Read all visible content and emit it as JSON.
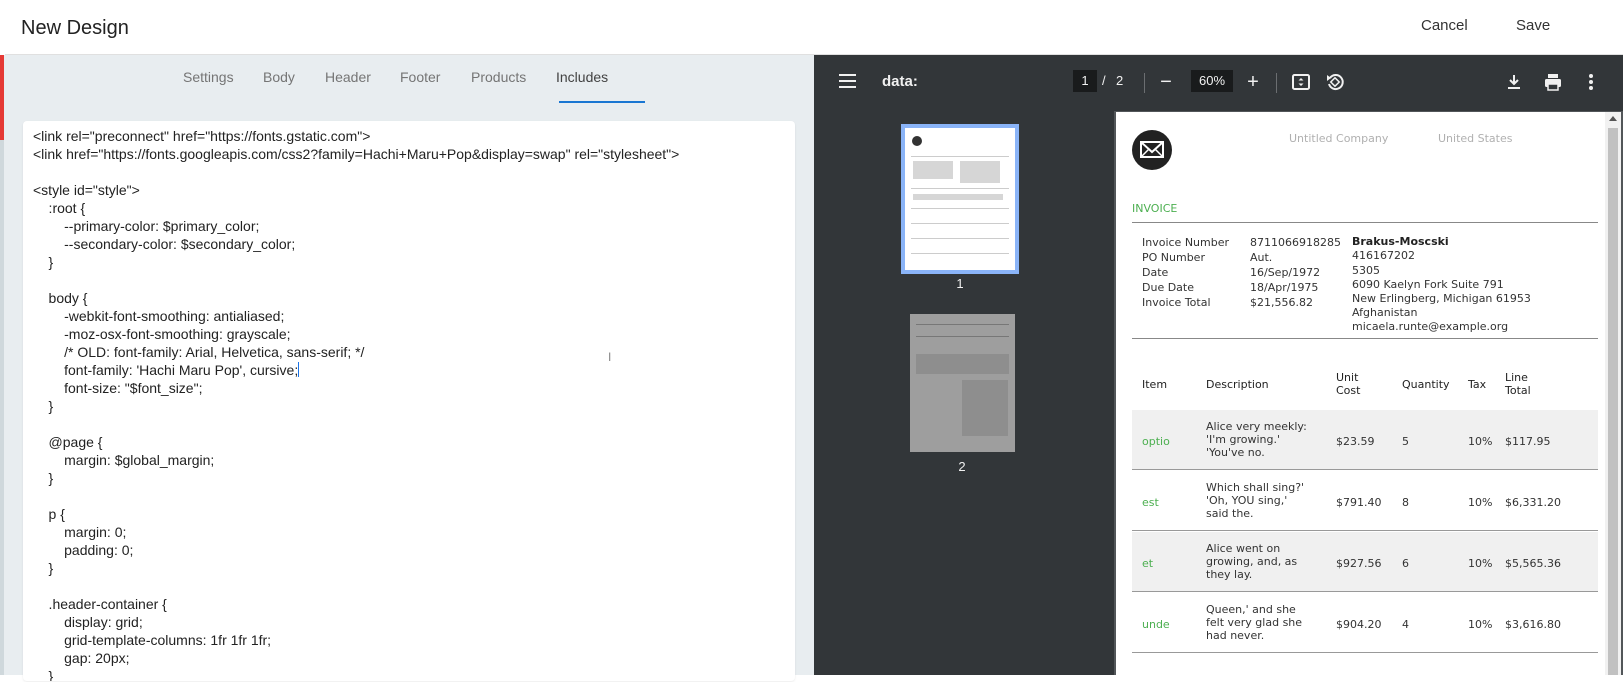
{
  "header": {
    "title": "New Design",
    "cancel_label": "Cancel",
    "save_label": "Save"
  },
  "tabs": [
    {
      "label": "Settings"
    },
    {
      "label": "Body"
    },
    {
      "label": "Header"
    },
    {
      "label": "Footer"
    },
    {
      "label": "Products"
    },
    {
      "label": "Includes",
      "active": true
    }
  ],
  "editor": {
    "code_before_caret": "<link rel=\"preconnect\" href=\"https://fonts.gstatic.com\">\n<link href=\"https://fonts.googleapis.com/css2?family=Hachi+Maru+Pop&display=swap\" rel=\"stylesheet\">\n\n<style id=\"style\">\n    :root {\n        --primary-color: $primary_color;\n        --secondary-color: $secondary_color;\n    }\n\n    body {\n        -webkit-font-smoothing: antialiased;\n        -moz-osx-font-smoothing: grayscale;\n        /* OLD: font-family: Arial, Helvetica, sans-serif; */\n        font-family: 'Hachi Maru Pop', cursive;",
    "code_after_caret": "\n        font-size: \"$font_size\";\n    }\n\n    @page {\n        margin: $global_margin;\n    }\n\n    p {\n        margin: 0;\n        padding: 0;\n    }\n\n    .header-container {\n        display: grid;\n        grid-template-columns: 1fr 1fr 1fr;\n        gap: 20px;\n    }"
  },
  "viewer": {
    "title": "data:",
    "current_page": "1",
    "page_separator": "/",
    "total_pages": "2",
    "zoom": "60%",
    "thumbnails": [
      {
        "label": "1"
      },
      {
        "label": "2"
      }
    ],
    "icons": [
      "menu-icon",
      "zoom-out-icon",
      "zoom-in-icon",
      "fit-page-icon",
      "rotate-icon",
      "download-icon",
      "print-icon",
      "more-icon"
    ]
  },
  "invoice": {
    "company_name": "Untitled Company",
    "company_country": "United States",
    "title": "INVOICE",
    "meta": [
      {
        "label": "Invoice Number",
        "value": "8711066918285"
      },
      {
        "label": "PO Number",
        "value": "Aut."
      },
      {
        "label": "Date",
        "value": "16/Sep/1972"
      },
      {
        "label": "Due Date",
        "value": "18/Apr/1975"
      },
      {
        "label": "Invoice Total",
        "value": "$21,556.82"
      }
    ],
    "client": {
      "name": "Brakus-Moscski",
      "lines": [
        "416167202",
        "5305",
        "6090 Kaelyn Fork Suite 791",
        "New Erlingberg, Michigan 61953",
        "Afghanistan",
        "micaela.runte@example.org"
      ]
    },
    "columns": {
      "item": "Item",
      "description": "Description",
      "unit_cost_1": "Unit",
      "unit_cost_2": "Cost",
      "quantity": "Quantity",
      "tax": "Tax",
      "line_total_1": "Line",
      "line_total_2": "Total"
    },
    "rows": [
      {
        "item": "optio",
        "description": [
          "Alice very meekly:",
          "'I'm growing.'",
          "'You've no."
        ],
        "unit_cost": "$23.59",
        "quantity": "5",
        "tax": "10%",
        "line_total": "$117.95"
      },
      {
        "item": "est",
        "description": [
          "Which shall sing?'",
          "'Oh, YOU sing,'",
          "said the."
        ],
        "unit_cost": "$791.40",
        "quantity": "8",
        "tax": "10%",
        "line_total": "$6,331.20"
      },
      {
        "item": "et",
        "description": [
          "Alice went on",
          "growing, and, as",
          "they lay."
        ],
        "unit_cost": "$927.56",
        "quantity": "6",
        "tax": "10%",
        "line_total": "$5,565.36"
      },
      {
        "item": "unde",
        "description": [
          "Queen,' and she",
          "felt very glad she",
          "had never."
        ],
        "unit_cost": "$904.20",
        "quantity": "4",
        "tax": "10%",
        "line_total": "$3,616.80"
      }
    ]
  }
}
